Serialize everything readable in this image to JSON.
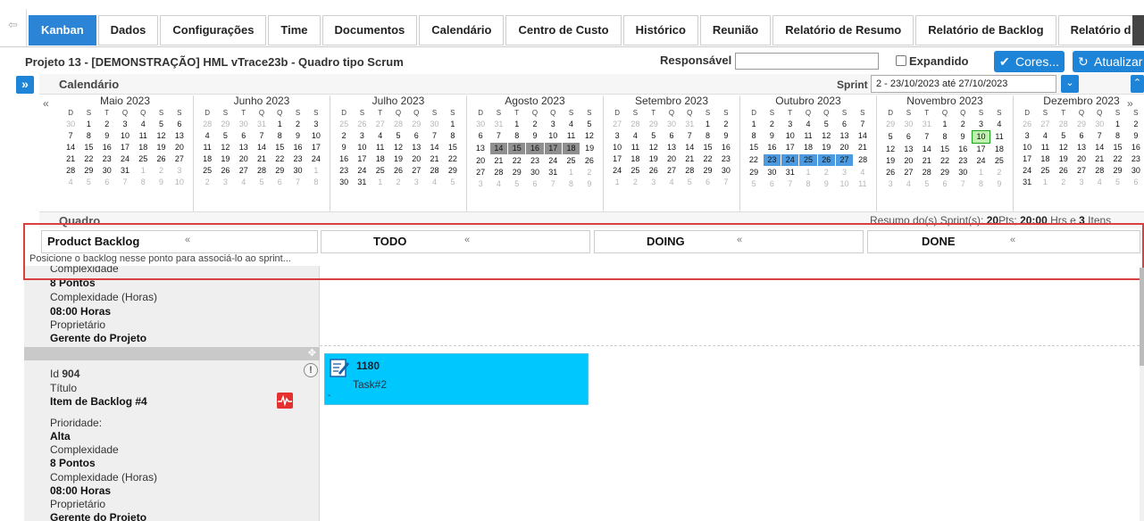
{
  "tabs": [
    {
      "label": "Kanban",
      "active": true
    },
    {
      "label": "Dados"
    },
    {
      "label": "Configurações"
    },
    {
      "label": "Time"
    },
    {
      "label": "Documentos"
    },
    {
      "label": "Calendário"
    },
    {
      "label": "Centro de Custo"
    },
    {
      "label": "Histórico"
    },
    {
      "label": "Reunião"
    },
    {
      "label": "Relatório de Resumo"
    },
    {
      "label": "Relatório de Backlog"
    },
    {
      "label": "Relatório d"
    }
  ],
  "project": {
    "title": "Projeto 13 - [DEMONSTRAÇÃO] HML vTrace23b - Quadro tipo Scrum",
    "responsavel_label": "Responsável",
    "responsavel_value": "",
    "expandido_label": "Expandido",
    "expandido_checked": false,
    "cores_label": "Cores...",
    "atualizar_label": "Atualizar"
  },
  "calendar": {
    "title": "Calendário",
    "sprint_label": "Sprint",
    "sprint_value": "2 - 23/10/2023 até 27/10/2023",
    "prev_icon": "«",
    "next_icon": "»",
    "dow": [
      "D",
      "S",
      "T",
      "Q",
      "Q",
      "S",
      "S"
    ],
    "months": [
      {
        "name": "Maio 2023",
        "first": "04-30",
        "days": [
          [
            30,
            1,
            2,
            3,
            4,
            5,
            6
          ],
          [
            7,
            8,
            9,
            10,
            11,
            12,
            13
          ],
          [
            14,
            15,
            16,
            17,
            18,
            19,
            20
          ],
          [
            21,
            22,
            23,
            24,
            25,
            26,
            27
          ],
          [
            28,
            29,
            30,
            31,
            1,
            2,
            3
          ],
          [
            4,
            5,
            6,
            7,
            8,
            9,
            10
          ]
        ],
        "mute_before": 1,
        "mute_after_from": [
          4,
          4
        ],
        "highlights": []
      },
      {
        "name": "Junho 2023",
        "days": [
          [
            28,
            29,
            30,
            31,
            1,
            2,
            3
          ],
          [
            4,
            5,
            6,
            7,
            8,
            9,
            10
          ],
          [
            11,
            12,
            13,
            14,
            15,
            16,
            17
          ],
          [
            18,
            19,
            20,
            21,
            22,
            23,
            24
          ],
          [
            25,
            26,
            27,
            28,
            29,
            30,
            1
          ],
          [
            2,
            3,
            4,
            5,
            6,
            7,
            8
          ]
        ],
        "mute_before": 4,
        "mute_after_from": [
          4,
          6
        ],
        "highlights": []
      },
      {
        "name": "Julho 2023",
        "days": [
          [
            25,
            26,
            27,
            28,
            29,
            30,
            1
          ],
          [
            2,
            3,
            4,
            5,
            6,
            7,
            8
          ],
          [
            9,
            10,
            11,
            12,
            13,
            14,
            15
          ],
          [
            16,
            17,
            18,
            19,
            20,
            21,
            22
          ],
          [
            23,
            24,
            25,
            26,
            27,
            28,
            29
          ],
          [
            30,
            31,
            1,
            2,
            3,
            4,
            5
          ]
        ],
        "mute_before": 6,
        "mute_after_from": [
          5,
          2
        ],
        "highlights": []
      },
      {
        "name": "Agosto 2023",
        "days": [
          [
            30,
            31,
            1,
            2,
            3,
            4,
            5
          ],
          [
            6,
            7,
            8,
            9,
            10,
            11,
            12
          ],
          [
            13,
            14,
            15,
            16,
            17,
            18,
            19
          ],
          [
            20,
            21,
            22,
            23,
            24,
            25,
            26
          ],
          [
            27,
            28,
            29,
            30,
            31,
            1,
            2
          ],
          [
            3,
            4,
            5,
            6,
            7,
            8,
            9
          ]
        ],
        "mute_before": 2,
        "mute_after_from": [
          4,
          5
        ],
        "highlights": [
          {
            "row": 2,
            "col": 1,
            "kind": "gray"
          },
          {
            "row": 2,
            "col": 2,
            "kind": "gray"
          },
          {
            "row": 2,
            "col": 3,
            "kind": "gray"
          },
          {
            "row": 2,
            "col": 4,
            "kind": "gray"
          },
          {
            "row": 2,
            "col": 5,
            "kind": "gray"
          }
        ]
      },
      {
        "name": "Setembro 2023",
        "days": [
          [
            27,
            28,
            29,
            30,
            31,
            1,
            2
          ],
          [
            3,
            4,
            5,
            6,
            7,
            8,
            9
          ],
          [
            10,
            11,
            12,
            13,
            14,
            15,
            16
          ],
          [
            17,
            18,
            19,
            20,
            21,
            22,
            23
          ],
          [
            24,
            25,
            26,
            27,
            28,
            29,
            30
          ],
          [
            1,
            2,
            3,
            4,
            5,
            6,
            7
          ]
        ],
        "mute_before": 5,
        "mute_after_from": [
          5,
          0
        ],
        "highlights": []
      },
      {
        "name": "Outubro 2023",
        "days": [
          [
            1,
            2,
            3,
            4,
            5,
            6,
            7
          ],
          [
            8,
            9,
            10,
            11,
            12,
            13,
            14
          ],
          [
            15,
            16,
            17,
            18,
            19,
            20,
            21
          ],
          [
            22,
            23,
            24,
            25,
            26,
            27,
            28
          ],
          [
            29,
            30,
            31,
            1,
            2,
            3,
            4
          ],
          [
            5,
            6,
            7,
            8,
            9,
            10,
            11
          ]
        ],
        "mute_before": 0,
        "mute_after_from": [
          4,
          3
        ],
        "highlights": [
          {
            "row": 3,
            "col": 1,
            "kind": "blue"
          },
          {
            "row": 3,
            "col": 2,
            "kind": "blue"
          },
          {
            "row": 3,
            "col": 3,
            "kind": "blue"
          },
          {
            "row": 3,
            "col": 4,
            "kind": "blue"
          },
          {
            "row": 3,
            "col": 5,
            "kind": "blue"
          }
        ]
      },
      {
        "name": "Novembro 2023",
        "days": [
          [
            29,
            30,
            31,
            1,
            2,
            3,
            4
          ],
          [
            5,
            6,
            7,
            8,
            9,
            10,
            11
          ],
          [
            12,
            13,
            14,
            15,
            16,
            17,
            18
          ],
          [
            19,
            20,
            21,
            22,
            23,
            24,
            25
          ],
          [
            26,
            27,
            28,
            29,
            30,
            1,
            2
          ],
          [
            3,
            4,
            5,
            6,
            7,
            8,
            9
          ]
        ],
        "mute_before": 3,
        "mute_after_from": [
          4,
          5
        ],
        "highlights": [
          {
            "row": 1,
            "col": 5,
            "kind": "today"
          }
        ]
      },
      {
        "name": "Dezembro 2023",
        "days": [
          [
            26,
            27,
            28,
            29,
            30,
            1,
            2
          ],
          [
            3,
            4,
            5,
            6,
            7,
            8,
            9
          ],
          [
            10,
            11,
            12,
            13,
            14,
            15,
            16
          ],
          [
            17,
            18,
            19,
            20,
            21,
            22,
            23
          ],
          [
            24,
            25,
            26,
            27,
            28,
            29,
            30
          ],
          [
            31,
            1,
            2,
            3,
            4,
            5,
            6
          ]
        ],
        "mute_before": 5,
        "mute_after_from": [
          5,
          1
        ],
        "highlights": []
      }
    ]
  },
  "quadro": {
    "title": "Quadro",
    "resumo_prefix": "Resumo do(s) Sprint(s): ",
    "resumo_pts": "20",
    "resumo_pts_label": "Pts; ",
    "resumo_hrs": "20:00",
    "resumo_hrs_label": " Hrs e ",
    "resumo_items": "3",
    "resumo_items_label": " Itens",
    "columns": [
      {
        "title": "Product Backlog"
      },
      {
        "title": "TODO"
      },
      {
        "title": "DOING"
      },
      {
        "title": "DONE"
      }
    ],
    "backlog_hint": "Posicione o backlog nesse ponto para associá-lo ao sprint..."
  },
  "backlog_items": [
    {
      "complexidade_label": "Complexidade",
      "complexidade": "8 Pontos",
      "complexidade_horas_label": "Complexidade (Horas)",
      "complexidade_horas": "08:00 Horas",
      "proprietario_label": "Proprietário",
      "proprietario": "Gerente do Projeto"
    },
    {
      "id_label": "Id",
      "id": "904",
      "titulo_label": "Título",
      "titulo": "Item de Backlog #4",
      "prioridade_label": "Prioridade:",
      "prioridade": "Alta",
      "complexidade_label": "Complexidade",
      "complexidade": "8 Pontos",
      "complexidade_horas_label": "Complexidade (Horas)",
      "complexidade_horas": "08:00 Horas",
      "proprietario_label": "Proprietário",
      "proprietario": "Gerente do Projeto"
    }
  ],
  "task": {
    "id": "1180",
    "name": "Task#2",
    "dash": "-",
    "color": "#00c8ff"
  },
  "icons": {
    "info": "!",
    "drag": "✥",
    "sidebar_toggle": "»",
    "collapse": "⌃",
    "chevron_left": "«",
    "select_arrow": "⌄",
    "scroll_left": "«"
  },
  "colors": {
    "accent": "#2b84d6",
    "highlight_gray": "#8f8f8f",
    "highlight_blue": "#4c9be0",
    "today": "#bff0b0",
    "frame": "#d94040"
  }
}
